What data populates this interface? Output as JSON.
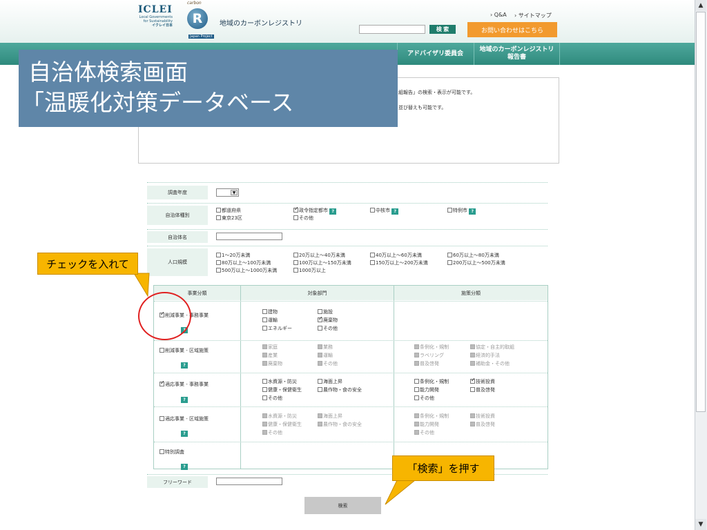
{
  "header": {
    "logo_iclei": "ICLEI",
    "logo_local": "Local Governments for Sustainability",
    "logo_jp": "イクレイ日本",
    "logo_carbon": "carbon",
    "logo_r": "R",
    "logo_japan_project": "Japan Project",
    "site_title": "地域のカーボンレジストリ",
    "topnav_qa": "› Q&A",
    "topnav_sitemap": "› サイトマップ",
    "search_button": "検 索",
    "contact_button": "お問い合わせはこちら"
  },
  "nav": {
    "advisory": "アドバイザリ委員会",
    "report_line1": "地域のカーボンレジストリ",
    "report_line2": "報告書"
  },
  "overlay": {
    "line1": "自治体検索画面",
    "line2": "「温暖化対策データベース"
  },
  "info": {
    "line1": "組報告」の検索・表示が可能です。",
    "line2": "並び替えも可能です。"
  },
  "form": {
    "year_label": "調査年度",
    "type_label": "自治体種別",
    "type_options": [
      "都道府県",
      "東京23区",
      "政令指定都市",
      "その他",
      "中核市",
      "特例市"
    ],
    "name_label": "自治体名",
    "pop_label": "人口規模",
    "pop_options": [
      "1～20万未満",
      "80万以上～100万未満",
      "500万以上～1000万未満",
      "20万以上～40万未満",
      "100万以上～150万未満",
      "1000万以上",
      "40万以上～60万未満",
      "150万以上～200万未満",
      "60万以上～80万未満",
      "200万以上～500万未満"
    ],
    "col_category": "事業分類",
    "col_sector": "対象部門",
    "col_policy": "施策分類",
    "cat1": "削減事業 - 事務事業",
    "cat1_sectors": [
      "建物",
      "運輸",
      "エネルギー",
      "施設",
      "廃棄物",
      "その他"
    ],
    "cat2": "削減事業 - 区域施策",
    "cat2_sectors": [
      "家庭",
      "産業",
      "廃棄物",
      "業務",
      "運輸",
      "その他"
    ],
    "cat2_policies": [
      "条例化・規制",
      "ラベリング",
      "普及啓発",
      "協定・自主的取組",
      "経済的手法",
      "補助金・その他"
    ],
    "cat3": "適応事業 - 事務事業",
    "cat3_sectors": [
      "水資源・防災",
      "健康・保健衛生",
      "その他",
      "海面上昇",
      "農作物・食の安全"
    ],
    "cat3_policies": [
      "条例化・規制",
      "能力開発",
      "その他",
      "技術投資",
      "普及啓発"
    ],
    "cat4": "適応事業 - 区域施策",
    "cat4_sectors": [
      "水資源・防災",
      "健康・保健衛生",
      "その他",
      "海面上昇",
      "農作物・食の安全"
    ],
    "cat4_policies": [
      "条例化・規制",
      "能力開発",
      "その他",
      "技術投資",
      "普及啓発"
    ],
    "cat5": "特別調査",
    "freeword_label": "フリーワード",
    "submit": "検索",
    "q": "?"
  },
  "annotations": {
    "check": "チェックを入れて",
    "search": "「検索」を押す"
  },
  "scroll": {
    "up": "▲",
    "down": "▼"
  }
}
